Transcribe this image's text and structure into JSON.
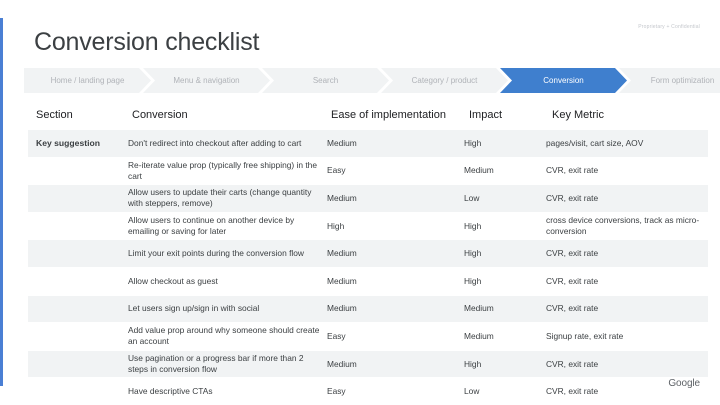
{
  "proprietary": "Proprietary + Confidential",
  "title": "Conversion checklist",
  "steps": [
    {
      "label": "Home / landing page",
      "active": false
    },
    {
      "label": "Menu & navigation",
      "active": false
    },
    {
      "label": "Search",
      "active": false
    },
    {
      "label": "Category / product",
      "active": false
    },
    {
      "label": "Conversion",
      "active": true
    },
    {
      "label": "Form optimization",
      "active": false
    }
  ],
  "table": {
    "headers": {
      "section": "Section",
      "conversion": "Conversion",
      "ease": "Ease of implementation",
      "impact": "Impact",
      "metric": "Key Metric"
    },
    "rows": [
      {
        "section": "Key suggestion",
        "conversion": "Don't redirect into checkout after adding to cart",
        "ease": "Medium",
        "impact": "High",
        "metric": "pages/visit, cart size, AOV"
      },
      {
        "section": "",
        "conversion": "Re-iterate value prop (typically free shipping) in the cart",
        "ease": "Easy",
        "impact": "Medium",
        "metric": "CVR, exit rate"
      },
      {
        "section": "",
        "conversion": "Allow users to update their carts (change quantity with steppers, remove)",
        "ease": "Medium",
        "impact": "Low",
        "metric": "CVR, exit rate"
      },
      {
        "section": "",
        "conversion": "Allow users to continue on another device by emailing or saving for later",
        "ease": "High",
        "impact": "High",
        "metric": "cross device conversions, track as micro-conversion"
      },
      {
        "section": "",
        "conversion": "Limit your exit points during the conversion flow",
        "ease": "Medium",
        "impact": "High",
        "metric": "CVR, exit rate"
      },
      {
        "section": "",
        "conversion": "Allow checkout as guest",
        "ease": "Medium",
        "impact": "High",
        "metric": "CVR, exit rate"
      },
      {
        "section": "",
        "conversion": "Let users sign up/sign in with social",
        "ease": "Medium",
        "impact": "Medium",
        "metric": "CVR, exit rate"
      },
      {
        "section": "",
        "conversion": "Add value prop around why someone should create an account",
        "ease": "Easy",
        "impact": "Medium",
        "metric": "Signup rate, exit rate"
      },
      {
        "section": "",
        "conversion": "Use pagination or a progress bar if more than 2 steps in conversion flow",
        "ease": "Medium",
        "impact": "High",
        "metric": "CVR, exit rate"
      },
      {
        "section": "",
        "conversion": "Have descriptive CTAs",
        "ease": "Easy",
        "impact": "Low",
        "metric": "CVR, exit rate"
      }
    ]
  },
  "brand": "Google",
  "colors": {
    "accent": "#3f7fce",
    "left_bar": "#4a7fd4",
    "row_shade": "#f1f3f4"
  }
}
